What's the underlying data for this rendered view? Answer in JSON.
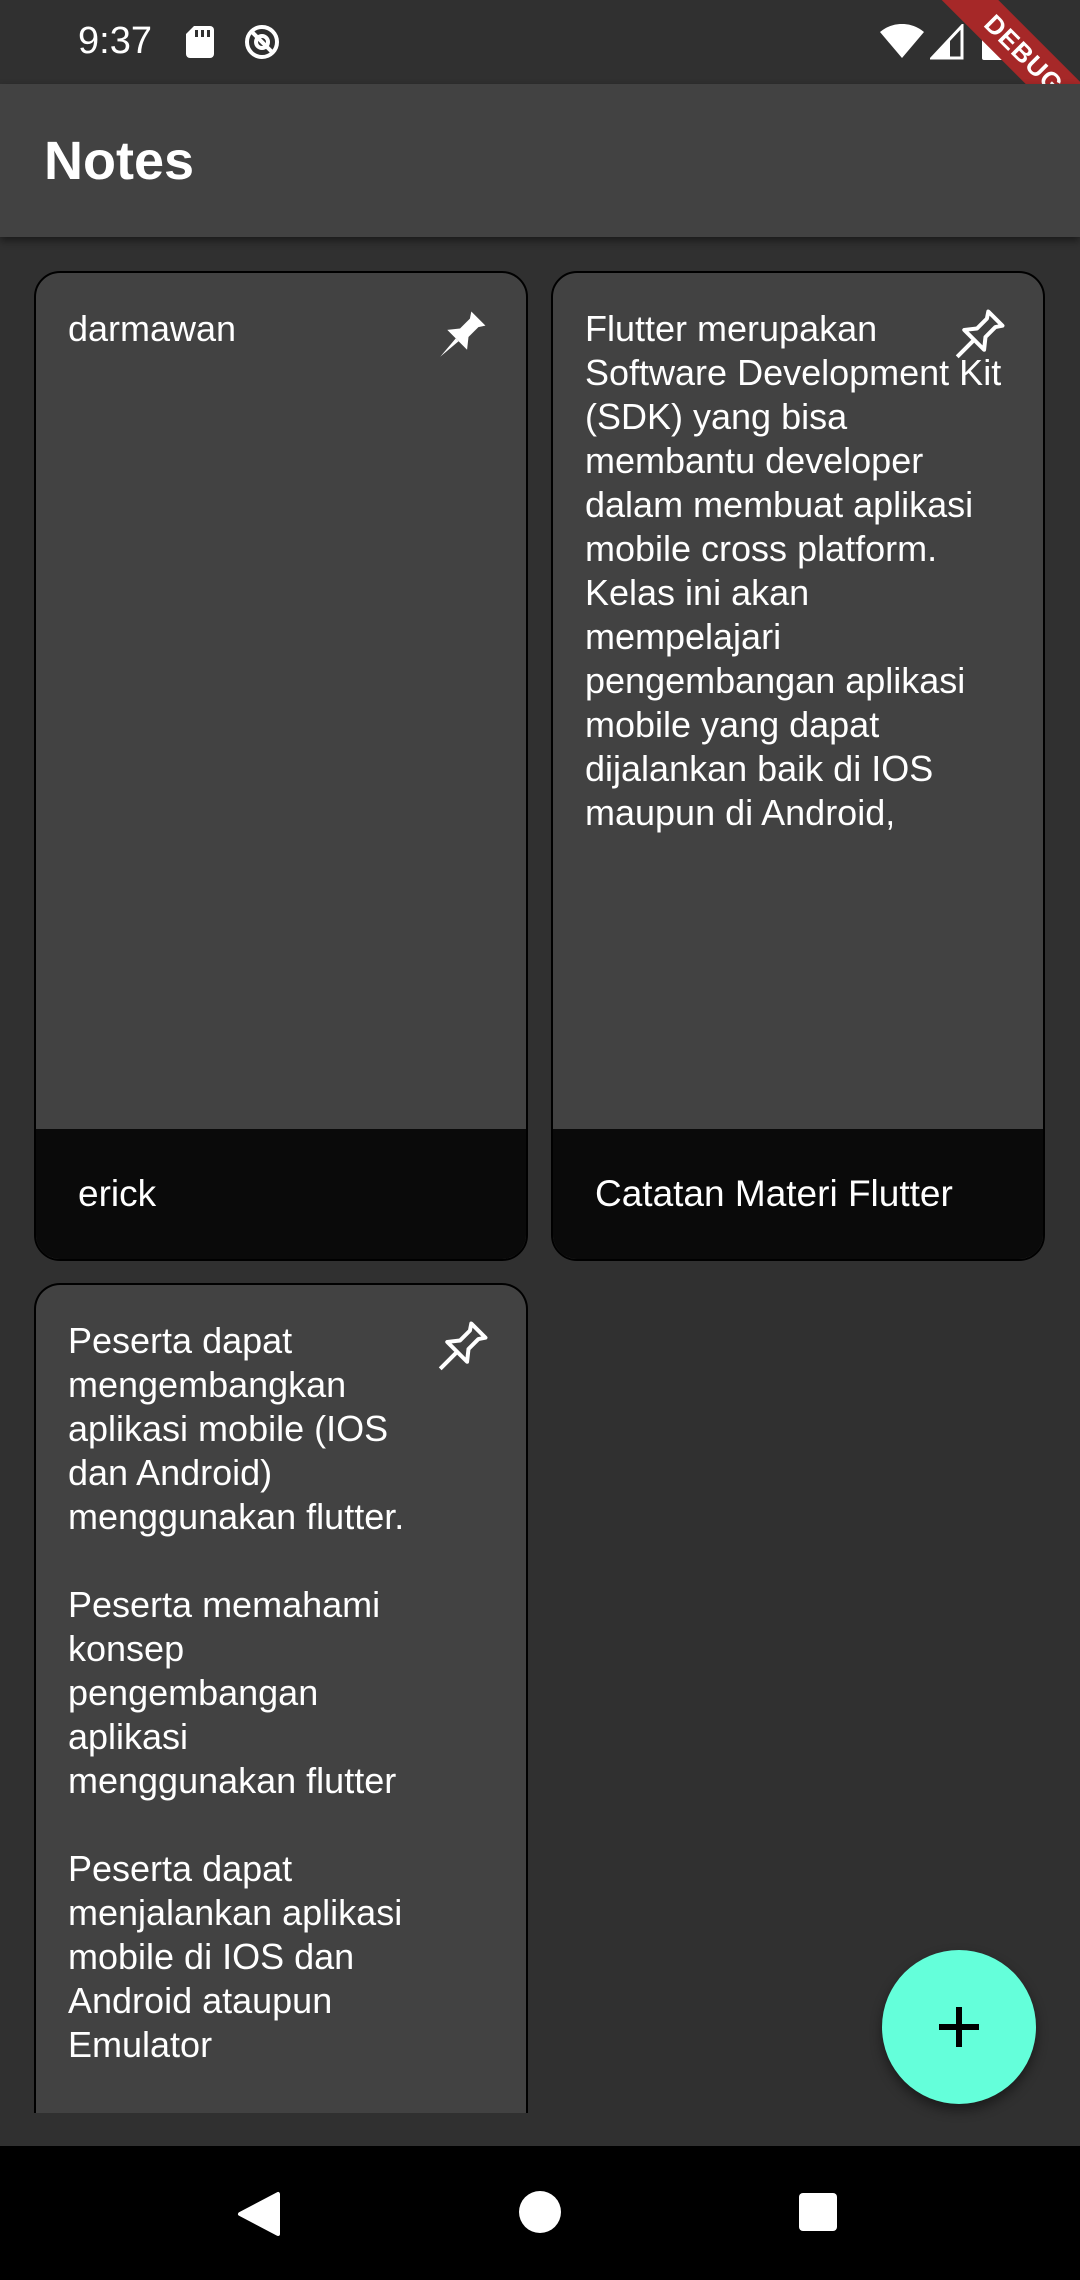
{
  "status_bar": {
    "time": "9:37",
    "icons": [
      "sd-card-icon",
      "do-not-disturb-icon",
      "wifi-icon",
      "signal-icon",
      "battery-icon"
    ]
  },
  "debug_banner": {
    "label": "DEBUG"
  },
  "app_bar": {
    "title": "Notes"
  },
  "notes": [
    {
      "body": "darmawan",
      "footer_title": "erick",
      "pinned": true,
      "pin_icon": "pin-filled-icon"
    },
    {
      "body": "Flutter merupakan Software Development Kit (SDK) yang bisa membantu developer dalam membuat aplikasi mobile cross platform. Kelas ini akan mempelajari pengembangan aplikasi mobile yang dapat dijalankan baik di IOS maupun di Android,",
      "footer_title": "Catatan Materi Flutter",
      "pinned": false,
      "pin_icon": "pin-outline-icon"
    },
    {
      "body": "Peserta dapat mengembangkan aplikasi mobile (IOS dan Android) menggunakan flutter.\n\nPeserta memahami konsep pengembangan aplikasi menggunakan flutter\n\nPeserta dapat menjalankan aplikasi mobile di IOS dan Android ataupun Emulator\n\nPeserta memahami",
      "footer_title": "",
      "pinned": false,
      "pin_icon": "pin-outline-icon"
    }
  ],
  "fab": {
    "icon": "add-icon",
    "color": "#64ffda"
  },
  "nav_bar": {
    "icons": [
      "back-icon",
      "home-icon",
      "recent-apps-icon"
    ]
  },
  "colors": {
    "background": "#303030",
    "app_bar": "#424242",
    "card": "#424242",
    "card_footer": "#0a0a0a",
    "debug_ribbon": "#a62828",
    "accent": "#64ffda"
  }
}
